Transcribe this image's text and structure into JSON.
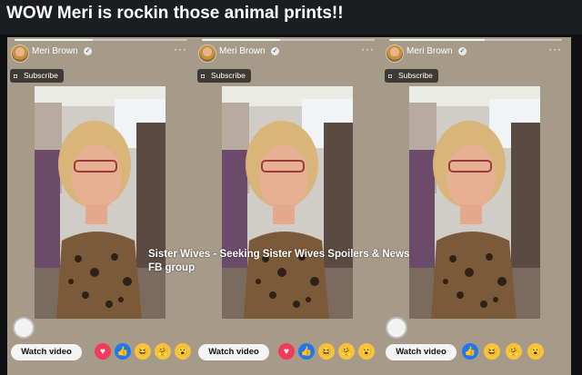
{
  "post": {
    "title": "WOW Meri is rockin those animal prints!!"
  },
  "panels": [
    {
      "author": "Meri Brown",
      "more": "···",
      "subscribe_label": "Subscribe",
      "watch_label": "Watch video",
      "progress": 0.45
    },
    {
      "author": "Meri Brown",
      "more": "···",
      "subscribe_label": "Subscribe",
      "watch_label": "Watch video",
      "progress": 0.45
    },
    {
      "author": "Meri Brown",
      "more": "···",
      "subscribe_label": "Subscribe",
      "watch_label": "Watch video",
      "progress": 0.55
    }
  ],
  "watermark": {
    "line1": "Sister Wives - Seeking Sister Wives Spoilers & News",
    "line2": "FB group"
  },
  "reactions": [
    "heart-icon",
    "like-icon",
    "haha-icon",
    "care-icon",
    "wow-icon"
  ],
  "colors": {
    "panel_bg": "#a69a89",
    "heart": "#f23a5a",
    "like": "#1f78f0",
    "emoji": "#f7c33b"
  }
}
